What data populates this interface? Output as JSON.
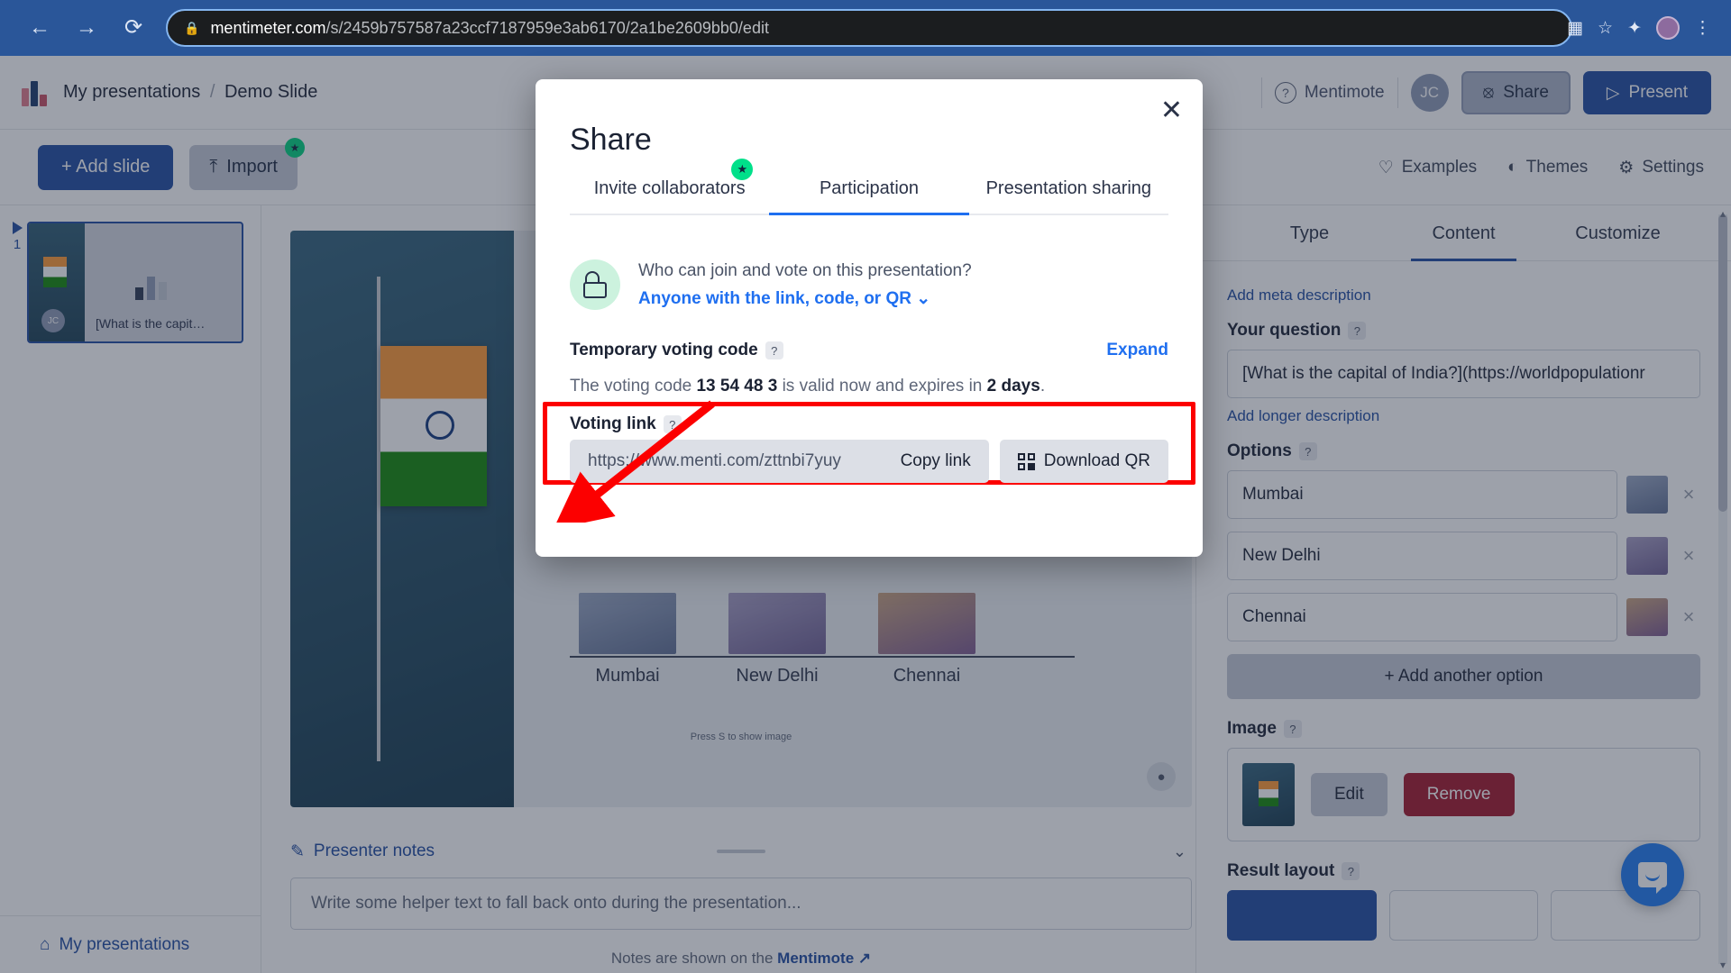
{
  "browser": {
    "back_icon": "←",
    "forward_icon": "→",
    "reload_icon": "⟳",
    "lock_icon": "🔒",
    "url_host": "mentimeter.com",
    "url_path": "/s/2459b757587a23ccf7187959e3ab6170/2a1be2609bb0/edit",
    "extensions_icon": "▦",
    "bookmark_icon": "☆",
    "puzzle_icon": "✦",
    "menu_icon": "⋮"
  },
  "header": {
    "breadcrumb_root": "My presentations",
    "breadcrumb_sep": "/",
    "breadcrumb_current": "Demo Slide",
    "help_icon": "?",
    "mentimote_label": "Mentimote",
    "avatar_initials": "JC",
    "share_icon": "⦻",
    "share_label": "Share",
    "present_icon": "▷",
    "present_label": "Present"
  },
  "toolbar": {
    "add_slide_label": "+ Add slide",
    "import_icon": "⤒",
    "import_label": "Import",
    "import_badge": "★",
    "examples_icon": "♡",
    "examples_label": "Examples",
    "themes_icon": "◐",
    "themes_label": "Themes",
    "settings_icon": "⚙",
    "settings_label": "Settings"
  },
  "slide_panel": {
    "slide_number": "1",
    "slide_avatar": "JC",
    "slide_label": "[What is the capit…",
    "footer_icon": "⌂",
    "footer_label": "My presentations"
  },
  "editor": {
    "question_title": "What is the capital of India?",
    "press_s_hint": "Press S to show image",
    "person_icon": "👤",
    "bar_labels": [
      "Mumbai",
      "New Delhi",
      "Chennai"
    ],
    "notes_icon": "✎",
    "notes_title": "Presenter notes",
    "notes_chevron": "⌄",
    "notes_placeholder": "Write some helper text to fall back onto during the presentation...",
    "notes_footer_prefix": "Notes are shown on the",
    "notes_footer_link": "Mentimote",
    "notes_footer_icon": "↗"
  },
  "properties": {
    "tabs": [
      {
        "label": "Type",
        "active": false
      },
      {
        "label": "Content",
        "active": true
      },
      {
        "label": "Customize",
        "active": false
      }
    ],
    "add_meta_description": "Add meta description",
    "question_label": "Your question",
    "help_chip": "?",
    "question_value": "[What is the capital of India?](https://worldpopulationr",
    "add_longer_description": "Add longer description",
    "options_label": "Options",
    "options": [
      "Mumbai",
      "New Delhi",
      "Chennai"
    ],
    "option_remove_icon": "×",
    "add_option_label": "+ Add another option",
    "image_label": "Image",
    "edit_label": "Edit",
    "remove_label": "Remove",
    "result_layout_label": "Result layout",
    "scroll_arrow_down": "▾",
    "scroll_arrow_up": "▴"
  },
  "chat": {
    "icon": "chat-bubble"
  },
  "modal": {
    "title": "Share",
    "close_icon": "✕",
    "tabs": [
      {
        "label": "Invite collaborators",
        "active": false,
        "badge": "★"
      },
      {
        "label": "Participation",
        "active": true,
        "badge": ""
      },
      {
        "label": "Presentation sharing",
        "active": false,
        "badge": ""
      }
    ],
    "lock_icon": "unlock-icon",
    "who_question": "Who can join and vote on this presentation?",
    "who_answer": "Anyone with the link, code, or QR",
    "who_chevron": "⌄",
    "voting_code_label": "Temporary voting code",
    "help_chip": "?",
    "expand_label": "Expand",
    "code_desc_prefix": "The voting code",
    "code_value": "13 54 48 3",
    "code_desc_middle": "is valid now and expires in",
    "code_expiry": "2 days",
    "code_desc_suffix": ".",
    "voting_link_label": "Voting link",
    "voting_link_url": "https://www.menti.com/zttnbi7yuy",
    "copy_link_label": "Copy link",
    "download_qr_label": "Download QR",
    "qr_icon": "qr-code-icon",
    "highlight_color": "#fc0000"
  }
}
